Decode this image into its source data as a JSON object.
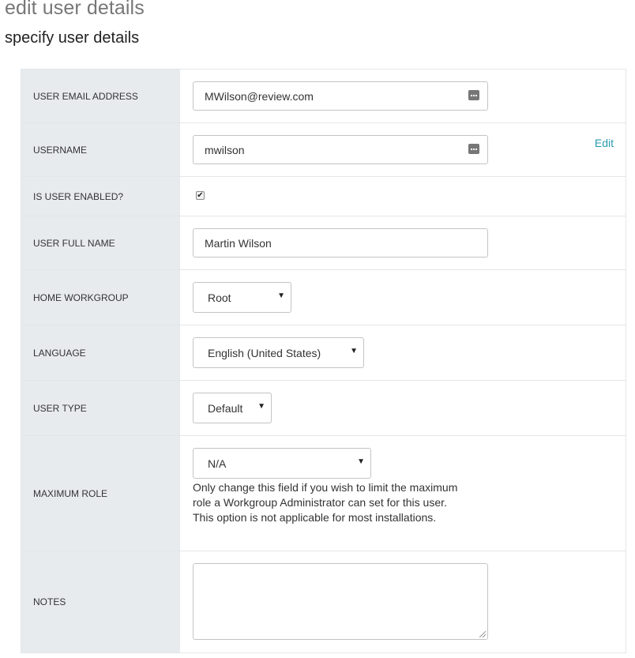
{
  "page": {
    "title": "edit user details",
    "subtitle": "specify user details"
  },
  "form": {
    "email": {
      "label": "USER EMAIL ADDRESS",
      "value": "MWilson@review.com",
      "icon": "keyboard-icon"
    },
    "username": {
      "label": "USERNAME",
      "value": "mwilson",
      "icon": "keyboard-icon",
      "edit_label": "Edit"
    },
    "enabled": {
      "label": "IS USER ENABLED?",
      "checked": true,
      "mark": "✔"
    },
    "full_name": {
      "label": "USER FULL NAME",
      "value": "Martin Wilson"
    },
    "home_workgroup": {
      "label": "HOME WORKGROUP",
      "value": "Root"
    },
    "language": {
      "label": "LANGUAGE",
      "value": "English (United States)"
    },
    "user_type": {
      "label": "USER TYPE",
      "value": "Default"
    },
    "maximum_role": {
      "label": "MAXIMUM ROLE",
      "value": "N/A",
      "help": "Only change this field if you wish to limit the maximum role a Workgroup Administrator can set for this user. This option is not applicable for most installations."
    },
    "notes": {
      "label": "NOTES",
      "value": ""
    },
    "caret": "▼"
  },
  "colors": {
    "label_bg": "#e8ebee",
    "link": "#2a9bb0",
    "border": "#c4c4c4"
  }
}
